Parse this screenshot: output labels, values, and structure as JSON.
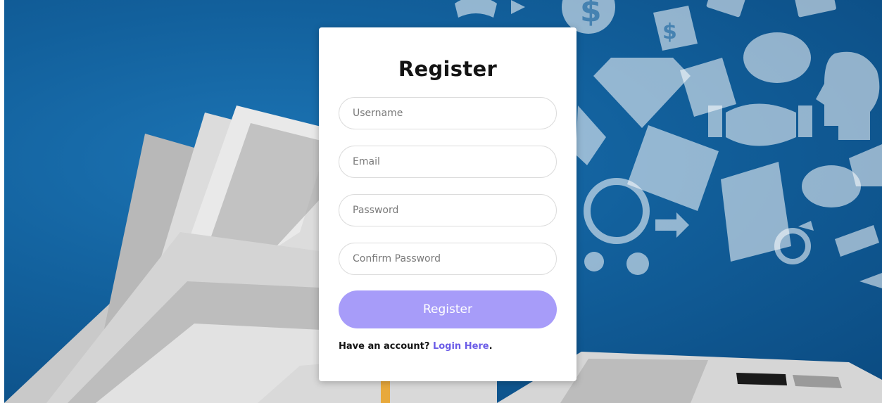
{
  "form": {
    "title": "Register",
    "fields": [
      {
        "placeholder": "Username",
        "value": ""
      },
      {
        "placeholder": "Email",
        "value": ""
      },
      {
        "placeholder": "Password",
        "value": ""
      },
      {
        "placeholder": "Confirm Password",
        "value": ""
      }
    ],
    "submit_label": "Register",
    "footer_text": "Have an account?",
    "footer_link": "Login Here",
    "footer_end": "."
  },
  "colors": {
    "background": "#12609c",
    "card": "#ffffff",
    "button": "#a79cf9",
    "link": "#6b5ce7"
  },
  "background_icons": [
    "dollar-icon",
    "money-bag-icon",
    "diamond-icon",
    "pie-chart-icon",
    "document-icon",
    "handshake-icon",
    "head-gears-icon",
    "safe-icon",
    "clock-icon",
    "piggy-bank-icon",
    "bank-icon",
    "banknote-icon",
    "ring-icon",
    "lightbulb-icon",
    "arrows-icon",
    "book-icon",
    "laptop-icon"
  ]
}
